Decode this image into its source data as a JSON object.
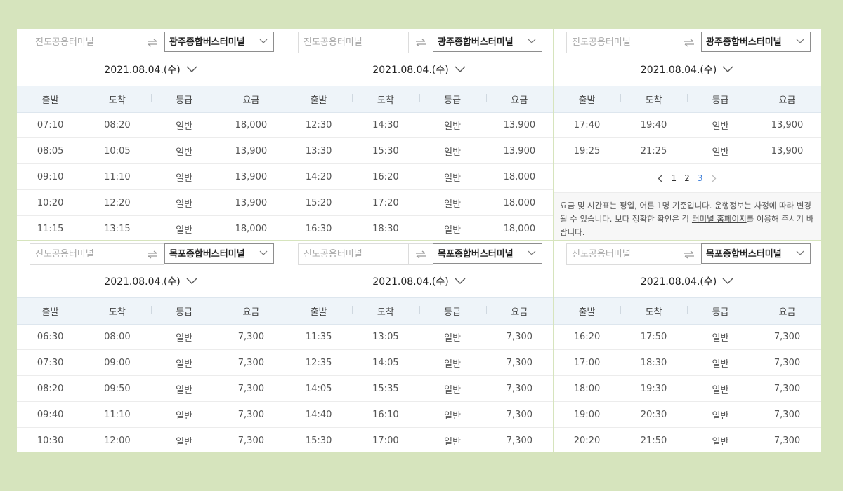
{
  "panels": [
    {
      "origin_placeholder": "진도공용터미널",
      "destination": "광주종합버스터미널",
      "date": "2021.08.04.(수)",
      "headers": [
        "출발",
        "도착",
        "등급",
        "요금"
      ],
      "rows": [
        [
          "07:10",
          "08:20",
          "일반",
          "18,000"
        ],
        [
          "08:05",
          "10:05",
          "일반",
          "13,900"
        ],
        [
          "09:10",
          "11:10",
          "일반",
          "13,900"
        ],
        [
          "10:20",
          "12:20",
          "일반",
          "13,900"
        ],
        [
          "11:15",
          "13:15",
          "일반",
          "18,000"
        ]
      ]
    },
    {
      "origin_placeholder": "진도공용터미널",
      "destination": "광주종합버스터미널",
      "date": "2021.08.04.(수)",
      "headers": [
        "출발",
        "도착",
        "등급",
        "요금"
      ],
      "rows": [
        [
          "12:30",
          "14:30",
          "일반",
          "13,900"
        ],
        [
          "13:30",
          "15:30",
          "일반",
          "13,900"
        ],
        [
          "14:20",
          "16:20",
          "일반",
          "18,000"
        ],
        [
          "15:20",
          "17:20",
          "일반",
          "18,000"
        ],
        [
          "16:30",
          "18:30",
          "일반",
          "18,000"
        ]
      ]
    },
    {
      "origin_placeholder": "진도공용터미널",
      "destination": "광주종합버스터미널",
      "date": "2021.08.04.(수)",
      "headers": [
        "출발",
        "도착",
        "등급",
        "요금"
      ],
      "rows": [
        [
          "17:40",
          "19:40",
          "일반",
          "13,900"
        ],
        [
          "19:25",
          "21:25",
          "일반",
          "13,900"
        ]
      ],
      "pagination": {
        "pages": [
          "1",
          "2",
          "3"
        ],
        "current": "3"
      },
      "notice": {
        "text_before": "요금 및 시간표는 평일, 어른 1명 기준입니다. 운행정보는 사정에 따라 변경될 수 있습니다. 보다 정확한 확인은 각 ",
        "link": "터미널 홈페이지",
        "text_after": "를 이용해 주시기 바랍니다."
      }
    },
    {
      "origin_placeholder": "진도공용터미널",
      "destination": "목포종합버스터미널",
      "date": "2021.08.04.(수)",
      "headers": [
        "출발",
        "도착",
        "등급",
        "요금"
      ],
      "rows": [
        [
          "06:30",
          "08:00",
          "일반",
          "7,300"
        ],
        [
          "07:30",
          "09:00",
          "일반",
          "7,300"
        ],
        [
          "08:20",
          "09:50",
          "일반",
          "7,300"
        ],
        [
          "09:40",
          "11:10",
          "일반",
          "7,300"
        ],
        [
          "10:30",
          "12:00",
          "일반",
          "7,300"
        ]
      ]
    },
    {
      "origin_placeholder": "진도공용터미널",
      "destination": "목포종합버스터미널",
      "date": "2021.08.04.(수)",
      "headers": [
        "출발",
        "도착",
        "등급",
        "요금"
      ],
      "rows": [
        [
          "11:35",
          "13:05",
          "일반",
          "7,300"
        ],
        [
          "12:35",
          "14:05",
          "일반",
          "7,300"
        ],
        [
          "14:05",
          "15:35",
          "일반",
          "7,300"
        ],
        [
          "14:40",
          "16:10",
          "일반",
          "7,300"
        ],
        [
          "15:30",
          "17:00",
          "일반",
          "7,300"
        ]
      ]
    },
    {
      "origin_placeholder": "진도공용터미널",
      "destination": "목포종합버스터미널",
      "date": "2021.08.04.(수)",
      "headers": [
        "출발",
        "도착",
        "등급",
        "요금"
      ],
      "rows": [
        [
          "16:20",
          "17:50",
          "일반",
          "7,300"
        ],
        [
          "17:00",
          "18:30",
          "일반",
          "7,300"
        ],
        [
          "18:00",
          "19:30",
          "일반",
          "7,300"
        ],
        [
          "19:00",
          "20:30",
          "일반",
          "7,300"
        ],
        [
          "20:20",
          "21:50",
          "일반",
          "7,300"
        ]
      ]
    }
  ],
  "icons": {
    "swap": "swap-arrows-icon",
    "dropdown": "chevron-down-icon",
    "prev": "chevron-left-icon",
    "next": "chevron-right-icon"
  },
  "colors": {
    "background": "#d6e4bd",
    "header_bg": "#eef4f9",
    "current_page": "#3b7dd8"
  }
}
